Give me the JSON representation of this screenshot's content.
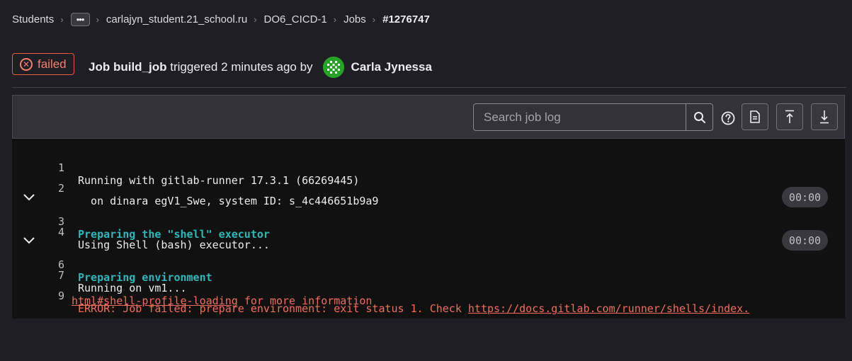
{
  "breadcrumb": {
    "items": [
      "Students",
      "carlajyn_student.21_school.ru",
      "DO6_CICD-1",
      "Jobs",
      "#1276747"
    ],
    "more_label": "•••"
  },
  "header": {
    "status": "failed",
    "job_prefix": "Job",
    "job_name": "build_job",
    "triggered_text": "triggered 2 minutes ago by",
    "user_name": "Carla Jynessa"
  },
  "toolbar": {
    "search_placeholder": "Search job log"
  },
  "log": {
    "lines": [
      {
        "num": "1",
        "text": "Running with gitlab-runner 17.3.1 (66269445)"
      },
      {
        "num": "2",
        "text": "  on dinara egV1_Swe, system ID: s_4c446651b9a9"
      },
      {
        "num": "3",
        "text": "Preparing the \"shell\" executor",
        "duration": "00:00"
      },
      {
        "num": "4",
        "text": "Using Shell (bash) executor..."
      },
      {
        "num": "6",
        "text": "Preparing environment",
        "duration": "00:00"
      },
      {
        "num": "7",
        "text": "Running on vm1..."
      },
      {
        "num": "9",
        "text_before": "ERROR: Job failed: prepare environment: exit status 1. Check ",
        "link_part1": "https://docs.gitlab.com/runner/shells/index.",
        "link_part2": "html#shell-profile-loading",
        "text_after": " for more information"
      }
    ]
  },
  "colors": {
    "failed": "#ec5941",
    "section": "#2cb8b8",
    "error": "#f26d5b",
    "background": "#1f1e24",
    "log_background": "#111112"
  }
}
